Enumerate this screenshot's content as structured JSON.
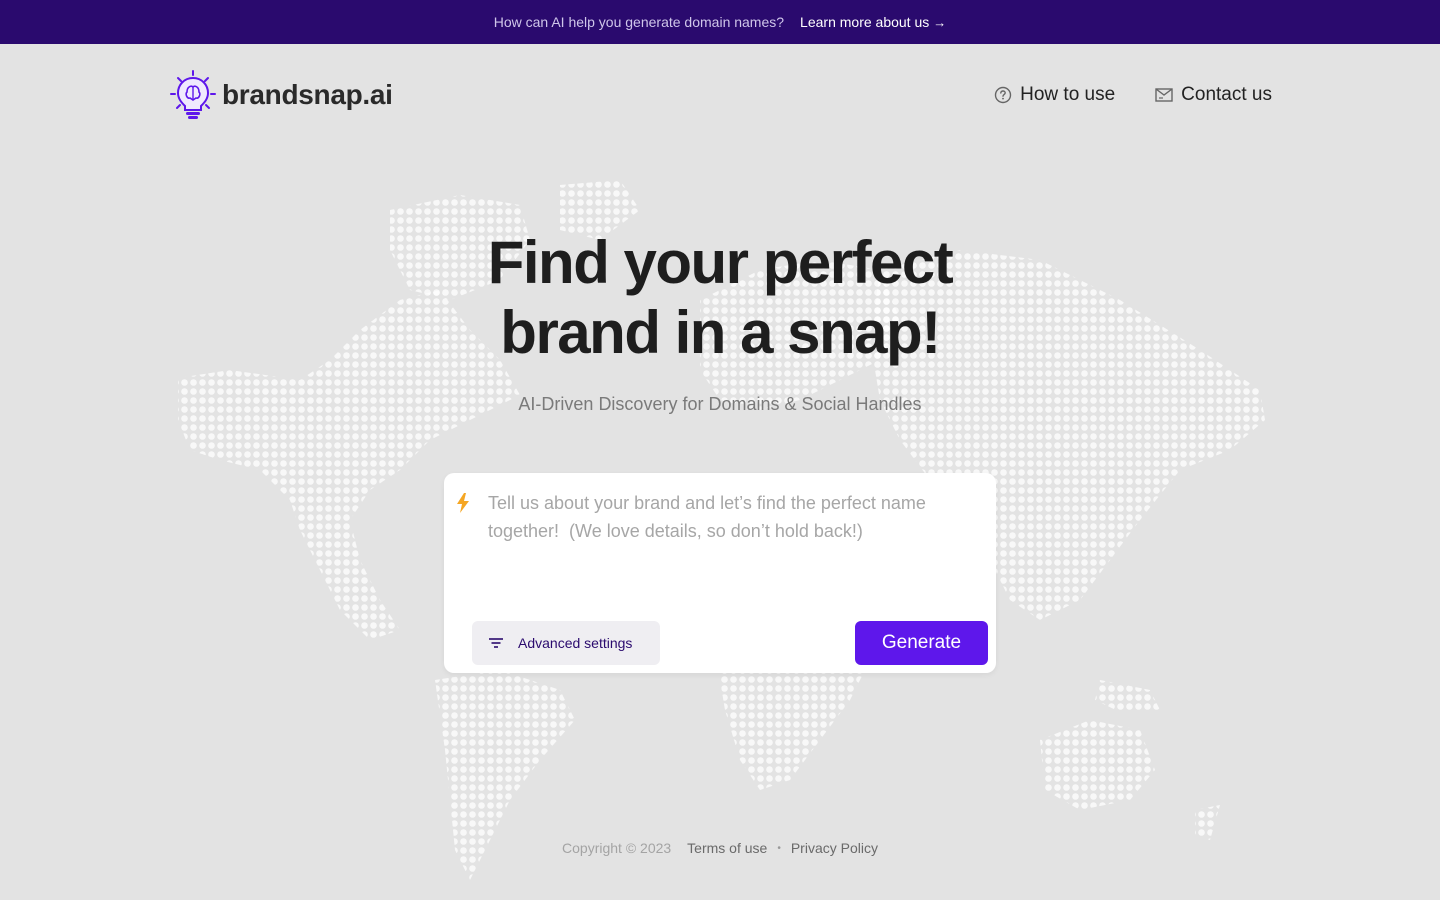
{
  "announcement": {
    "message": "How can AI help you generate domain names?",
    "link_label": "Learn more about us",
    "link_arrow": "→"
  },
  "header": {
    "logo_text": "brandsnap.ai",
    "nav": [
      {
        "label": "How to use",
        "icon": "question-circle-icon"
      },
      {
        "label": "Contact us",
        "icon": "mail-icon"
      }
    ]
  },
  "hero": {
    "title_line1": "Find your perfect",
    "title_line2": "brand in a snap!",
    "subtitle": "AI-Driven Discovery for Domains & Social Handles"
  },
  "prompt_card": {
    "icon": "lightning-icon",
    "placeholder": "Tell us about your brand and let’s find the perfect name together!  (We love details, so don’t hold back!)",
    "value": "",
    "advanced_label": "Advanced settings",
    "generate_label": "Generate"
  },
  "footer": {
    "copyright": "Copyright © 2023",
    "terms": "Terms of use",
    "separator": "•",
    "privacy": "Privacy Policy"
  },
  "colors": {
    "announcement_bg": "#2a0a6e",
    "page_bg": "#e3e3e3",
    "accent": "#5e17eb",
    "bolt": "#f5a623"
  }
}
